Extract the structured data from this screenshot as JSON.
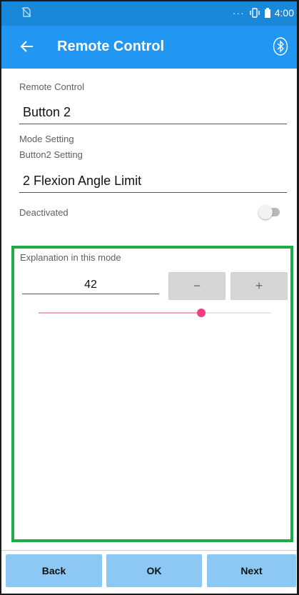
{
  "status_bar": {
    "dots": "···",
    "time": "4:00",
    "icons": [
      "no-sim-icon",
      "vibrate-icon",
      "battery-icon"
    ]
  },
  "app_bar": {
    "title": "Remote Control",
    "icons": [
      "back-arrow-icon",
      "bluetooth-icon"
    ]
  },
  "form": {
    "remote_control_label": "Remote Control",
    "remote_control_value": "Button 2",
    "mode_setting_label": "Mode Setting",
    "button_setting_label": "Button2 Setting",
    "button_setting_value": "2 Flexion Angle Limit",
    "toggle_label": "Deactivated",
    "toggle_on": false
  },
  "mode_panel": {
    "explanation_label": "Explanation in this mode",
    "stepper_value": "42",
    "minus_label": "−",
    "plus_label": "+",
    "slider_fraction": 0.7
  },
  "footer": {
    "back_label": "Back",
    "ok_label": "OK",
    "next_label": "Next"
  },
  "colors": {
    "status_bar": "#1a88d8",
    "app_bar": "#2196f3",
    "panel_border": "#1fab47",
    "slider_accent": "#f03e86",
    "footer_button": "#8cc8f3"
  }
}
